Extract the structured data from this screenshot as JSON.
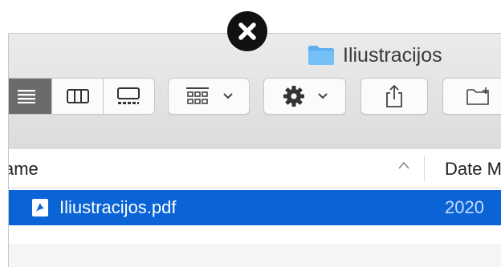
{
  "window": {
    "title": "Iliustracijos",
    "folder_icon": "folder-icon"
  },
  "overlay": {
    "icon": "close-icon"
  },
  "toolbar": {
    "view_modes": [
      "list-view-icon",
      "column-view-icon",
      "gallery-view-icon"
    ],
    "active_view": "list",
    "group_icon": "group-by-icon",
    "action_icon": "gear-icon",
    "share_icon": "share-icon",
    "new_folder_icon": "new-folder-icon"
  },
  "list": {
    "columns": [
      "ame",
      "Date M"
    ],
    "sorted_by": "name",
    "rows": [
      {
        "name": "Iliustracijos.pdf",
        "date": "2020 ",
        "selected": true,
        "icon": "pdf-icon"
      }
    ]
  },
  "colors": {
    "selection": "#0a64d6",
    "folder": "#5aaef0",
    "active_segment": "#6b6b6b"
  }
}
